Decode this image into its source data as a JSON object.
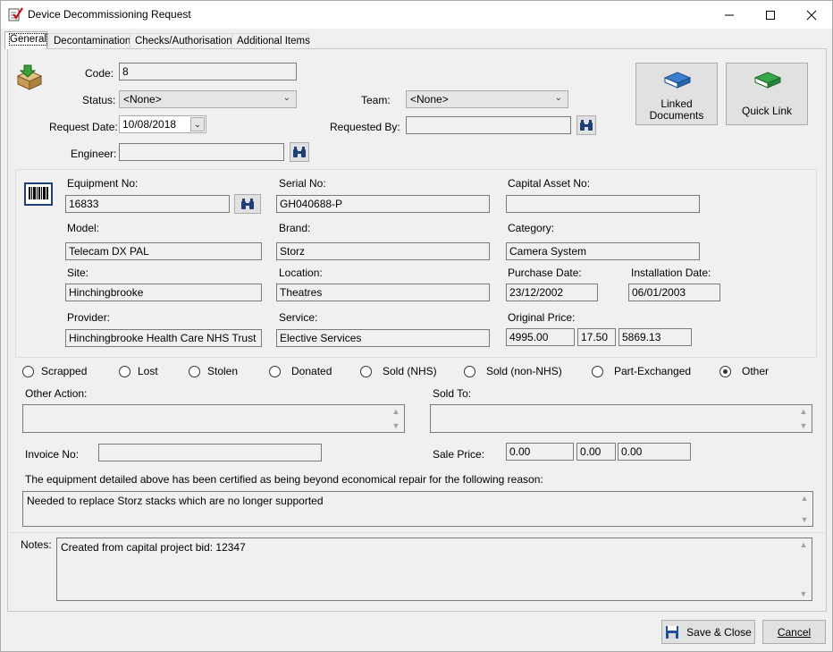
{
  "window": {
    "title": "Device Decommissioning Request",
    "minimize": "—",
    "maximize": "☐",
    "close": "✕"
  },
  "tabs": [
    {
      "label": "General",
      "active": true
    },
    {
      "label": "Decontamination",
      "active": false
    },
    {
      "label": "Checks/Authorisation",
      "active": false
    },
    {
      "label": "Additional Items",
      "active": false
    }
  ],
  "header": {
    "code_label": "Code:",
    "code_value": "8",
    "status_label": "Status:",
    "status_value": "<None>",
    "team_label": "Team:",
    "team_value": "<None>",
    "request_date_label": "Request Date:",
    "request_date_value": "10/08/2018",
    "requested_by_label": "Requested By:",
    "requested_by_value": "",
    "engineer_label": "Engineer:",
    "engineer_value": "",
    "linked_documents_label": "Linked",
    "linked_documents_label2": "Documents",
    "quick_link_label": "Quick Link"
  },
  "equipment": {
    "equipment_no_label": "Equipment No:",
    "equipment_no_value": "16833",
    "serial_no_label": "Serial No:",
    "serial_no_value": "GH040688-P",
    "capital_asset_no_label": "Capital Asset No:",
    "capital_asset_no_value": "",
    "model_label": "Model:",
    "model_value": "Telecam DX PAL",
    "brand_label": "Brand:",
    "brand_value": "Storz",
    "category_label": "Category:",
    "category_value": "Camera System",
    "site_label": "Site:",
    "site_value": "Hinchingbrooke",
    "location_label": "Location:",
    "location_value": "Theatres",
    "purchase_date_label": "Purchase Date:",
    "purchase_date_value": "23/12/2002",
    "installation_date_label": "Installation Date:",
    "installation_date_value": "06/01/2003",
    "provider_label": "Provider:",
    "provider_value": "Hinchingbrooke Health Care NHS Trust",
    "service_label": "Service:",
    "service_value": "Elective Services",
    "original_price_label": "Original Price:",
    "original_price_net": "4995.00",
    "original_price_vat": "17.50",
    "original_price_gross": "5869.13"
  },
  "disposal": {
    "options": [
      {
        "label": "Scrapped",
        "selected": false
      },
      {
        "label": "Lost",
        "selected": false
      },
      {
        "label": "Stolen",
        "selected": false
      },
      {
        "label": "Donated",
        "selected": false
      },
      {
        "label": "Sold (NHS)",
        "selected": false
      },
      {
        "label": "Sold (non-NHS)",
        "selected": false
      },
      {
        "label": "Part-Exchanged",
        "selected": false
      },
      {
        "label": "Other",
        "selected": true
      }
    ],
    "other_action_label": "Other Action:",
    "other_action_value": "",
    "sold_to_label": "Sold To:",
    "sold_to_value": "",
    "invoice_no_label": "Invoice No:",
    "invoice_no_value": "",
    "sale_price_label": "Sale Price:",
    "sale_price_net": "0.00",
    "sale_price_vat": "0.00",
    "sale_price_gross": "0.00",
    "reason_label": "The equipment detailed above has been certified as being beyond economical repair for the following reason:",
    "reason_value": "Needed to replace Storz stacks which are no longer supported"
  },
  "notes": {
    "label": "Notes:",
    "value": "Created from capital project bid: 12347"
  },
  "footer": {
    "save_close_label": "Save & Close",
    "cancel_label": "Cancel"
  }
}
